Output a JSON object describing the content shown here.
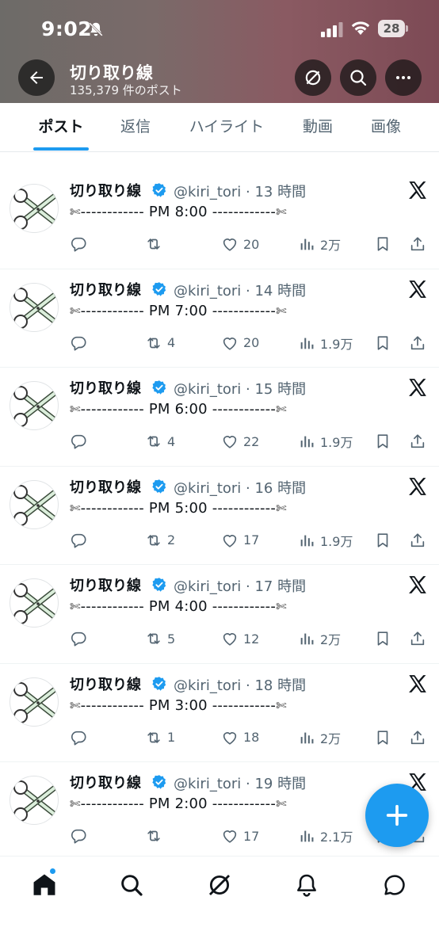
{
  "status_bar": {
    "time": "9:02",
    "battery": "28"
  },
  "header": {
    "title": "切り取り線",
    "subtitle": "135,379 件のポスト",
    "gradient_colors": [
      "#6d6b68",
      "#8a5a62",
      "#7d4a55"
    ]
  },
  "tabs": [
    {
      "label": "ポスト",
      "active": true
    },
    {
      "label": "返信",
      "active": false
    },
    {
      "label": "ハイライト",
      "active": false
    },
    {
      "label": "動画",
      "active": false
    },
    {
      "label": "画像",
      "active": false
    }
  ],
  "tweets": [
    {
      "name": "切り取り線",
      "meta": "@kiri_tori · 13 時間",
      "text": "------------ PM 8:00 ------------",
      "retweets": "",
      "likes": "20",
      "views": "2万"
    },
    {
      "name": "切り取り線",
      "meta": "@kiri_tori · 14 時間",
      "text": "------------ PM 7:00 ------------",
      "retweets": "4",
      "likes": "20",
      "views": "1.9万"
    },
    {
      "name": "切り取り線",
      "meta": "@kiri_tori · 15 時間",
      "text": "------------ PM 6:00 ------------",
      "retweets": "4",
      "likes": "22",
      "views": "1.9万"
    },
    {
      "name": "切り取り線",
      "meta": "@kiri_tori · 16 時間",
      "text": "------------ PM 5:00 ------------",
      "retweets": "2",
      "likes": "17",
      "views": "1.9万"
    },
    {
      "name": "切り取り線",
      "meta": "@kiri_tori · 17 時間",
      "text": "------------ PM 4:00 ------------",
      "retweets": "5",
      "likes": "12",
      "views": "2万"
    },
    {
      "name": "切り取り線",
      "meta": "@kiri_tori · 18 時間",
      "text": "------------ PM 3:00 ------------",
      "retweets": "1",
      "likes": "18",
      "views": "2万"
    },
    {
      "name": "切り取り線",
      "meta": "@kiri_tori · 19 時間",
      "text": "------------ PM 2:00 ------------",
      "retweets": "",
      "likes": "17",
      "views": "2.1万"
    }
  ],
  "icons": {
    "scissors": "✄",
    "accent": "#1d9bf0"
  },
  "bottom_nav": [
    "home-icon",
    "search-icon",
    "grok-icon",
    "notifications-icon",
    "messages-icon"
  ]
}
